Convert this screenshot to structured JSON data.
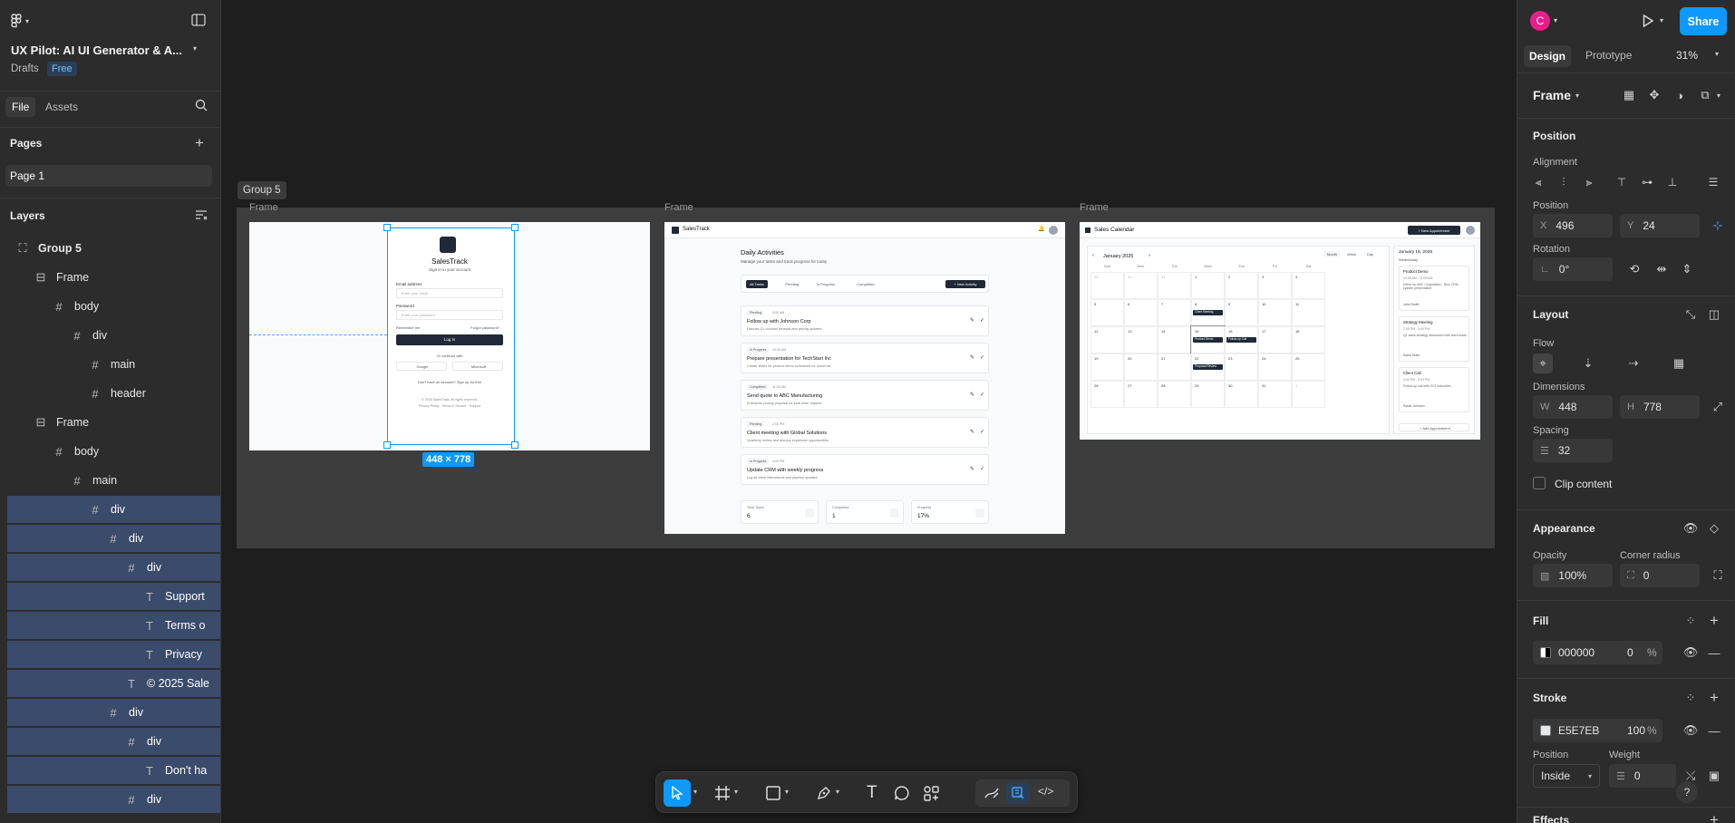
{
  "app": {
    "title": "UX Pilot: AI UI Generator & A...",
    "drafts": "Drafts",
    "plan_badge": "Free",
    "tabs": [
      "File",
      "Assets"
    ],
    "pages_label": "Pages",
    "page_name": "Page 1",
    "layers_label": "Layers"
  },
  "layers": [
    {
      "icon": "group",
      "name": "Group 5",
      "depth": 0,
      "bold": true,
      "selected": false
    },
    {
      "icon": "frame",
      "name": "Frame",
      "depth": 1,
      "selected": false
    },
    {
      "icon": "grid",
      "name": "body",
      "depth": 2,
      "selected": false
    },
    {
      "icon": "grid",
      "name": "div",
      "depth": 3,
      "selected": false
    },
    {
      "icon": "grid",
      "name": "main",
      "depth": 4,
      "selected": false
    },
    {
      "icon": "grid",
      "name": "header",
      "depth": 4,
      "selected": false
    },
    {
      "icon": "frame",
      "name": "Frame",
      "depth": 1,
      "selected": false
    },
    {
      "icon": "grid",
      "name": "body",
      "depth": 2,
      "selected": false
    },
    {
      "icon": "grid",
      "name": "main",
      "depth": 3,
      "selected": false
    },
    {
      "icon": "grid",
      "name": "div",
      "depth": 4,
      "selected": true
    },
    {
      "icon": "grid",
      "name": "div",
      "depth": 5,
      "selected": true
    },
    {
      "icon": "grid",
      "name": "div",
      "depth": 6,
      "selected": true
    },
    {
      "icon": "text",
      "name": "Support",
      "depth": 7,
      "selected": true
    },
    {
      "icon": "text",
      "name": "Terms o",
      "depth": 7,
      "selected": true
    },
    {
      "icon": "text",
      "name": "Privacy",
      "depth": 7,
      "selected": true
    },
    {
      "icon": "text",
      "name": "© 2025 Sale",
      "depth": 6,
      "selected": true
    },
    {
      "icon": "grid",
      "name": "div",
      "depth": 5,
      "selected": true
    },
    {
      "icon": "grid",
      "name": "div",
      "depth": 6,
      "selected": true
    },
    {
      "icon": "text",
      "name": "Don't ha",
      "depth": 7,
      "selected": true
    },
    {
      "icon": "grid",
      "name": "div",
      "depth": 6,
      "selected": true
    }
  ],
  "canvas": {
    "group_label": "Group 5",
    "frame_labels": [
      "Frame",
      "Frame",
      "Frame"
    ],
    "size_badge": "448 × 778"
  },
  "login": {
    "brand": "SalesTrack",
    "subtitle": "Sign in to your account",
    "email_label": "Email address",
    "email_placeholder": "Enter your email",
    "password_label": "Password",
    "password_placeholder": "Enter your password",
    "remember": "Remember me",
    "forgot": "Forgot password?",
    "login_button": "Log in",
    "continue_with": "Or continue with",
    "google": "Google",
    "microsoft": "Microsoft",
    "signup": "Don't have an account? Sign up for free",
    "footer": "© 2025 SalesTrack. All rights reserved.",
    "footer_links": [
      "Privacy Policy",
      "Terms of Service",
      "Support"
    ]
  },
  "activities": {
    "brand": "SalesTrack",
    "title": "Daily Activities",
    "subtitle": "Manage your tasks and track progress for today",
    "filters": [
      "All Tasks",
      "Pending",
      "In Progress",
      "Completed"
    ],
    "new_button": "+ New Activity",
    "tasks": [
      {
        "status": "Pending",
        "time": "9:00 AM",
        "title": "Follow up with Johnson Corp",
        "desc": "Discuss Q1 contract renewal and pricing updates"
      },
      {
        "status": "In Progress",
        "time": "10:30 AM",
        "title": "Prepare presentation for TechStart Inc",
        "desc": "Create slides for product demo scheduled for tomorrow"
      },
      {
        "status": "Completed",
        "time": "11:00 AM",
        "title": "Send quote to ABC Manufacturing",
        "desc": "Enterprise pricing proposal for bulk order request"
      },
      {
        "status": "Pending",
        "time": "2:00 PM",
        "title": "Client meeting with Global Solutions",
        "desc": "Quarterly review and discuss expansion opportunities"
      },
      {
        "status": "In Progress",
        "time": "4:00 PM",
        "title": "Update CRM with weekly progress",
        "desc": "Log all client interactions and pipeline updates"
      }
    ],
    "stats": [
      {
        "label": "Total Tasks",
        "value": "6"
      },
      {
        "label": "Completed",
        "value": "1"
      },
      {
        "label": "Progress",
        "value": "17%"
      }
    ]
  },
  "calendar": {
    "title": "Sales Calendar",
    "new_button": "+ New Appointment",
    "month": "January 2025",
    "views": [
      "Month",
      "Week",
      "Day"
    ],
    "weekdays": [
      "Sun",
      "Mon",
      "Tue",
      "Wed",
      "Thu",
      "Fri",
      "Sat"
    ],
    "days": [
      "29",
      "30",
      "31",
      "1",
      "2",
      "3",
      "4",
      "5",
      "6",
      "7",
      "8",
      "9",
      "10",
      "11",
      "12",
      "13",
      "14",
      "15",
      "16",
      "17",
      "18",
      "19",
      "20",
      "21",
      "22",
      "23",
      "24",
      "25",
      "26",
      "27",
      "28",
      "29",
      "30",
      "31",
      "1"
    ],
    "events": [
      {
        "cell": 10,
        "label": "Client Meeting"
      },
      {
        "cell": 17,
        "label": "Product Demo"
      },
      {
        "cell": 18,
        "label": "Follow-up Call"
      },
      {
        "cell": 24,
        "label": "Proposal Review"
      }
    ],
    "side_date": "January 15, 2025",
    "side_day": "Wednesday",
    "appointments": [
      {
        "title": "Product Demo",
        "time": "10:00 AM - 11:00 AM",
        "desc": "Demo for ABC Corporation - New CRM system presentation",
        "person": "John Smith"
      },
      {
        "title": "Strategy Meeting",
        "time": "2:00 PM - 3:00 PM",
        "desc": "Q1 sales strategy discussion with team leads",
        "person": "Sales Team"
      },
      {
        "title": "Client Call",
        "time": "4:30 PM - 5:00 PM",
        "desc": "Follow-up call with XYZ Industries",
        "person": "Sarah Johnson"
      }
    ],
    "add_button": "+ Add Appointment"
  },
  "design_panel": {
    "avatar_letter": "C",
    "share": "Share",
    "tabs": [
      "Design",
      "Prototype"
    ],
    "zoom": "31%",
    "frame_label": "Frame",
    "position_section": "Position",
    "alignment_label": "Alignment",
    "position_label": "Position",
    "x_label": "X",
    "x_value": "496",
    "y_label": "Y",
    "y_value": "24",
    "rotation_label": "Rotation",
    "rotation_value": "0°",
    "layout_section": "Layout",
    "flow_label": "Flow",
    "dimensions_label": "Dimensions",
    "w_label": "W",
    "w_value": "448",
    "h_label": "H",
    "h_value": "778",
    "spacing_label": "Spacing",
    "spacing_value": "32",
    "clip_content": "Clip content",
    "appearance_section": "Appearance",
    "opacity_label": "Opacity",
    "opacity_value": "100%",
    "radius_label": "Corner radius",
    "radius_value": "0",
    "fill_section": "Fill",
    "fill_hex": "000000",
    "fill_opacity": "0",
    "stroke_section": "Stroke",
    "stroke_hex": "E5E7EB",
    "stroke_opacity": "100",
    "percent": "%",
    "stroke_position_label": "Position",
    "stroke_position_value": "Inside",
    "weight_label": "Weight",
    "weight_value": "0",
    "effects_section": "Effects"
  },
  "colors": {
    "accent": "#0d99ff",
    "selection": "#3a4b6b",
    "avatar": "#e91e8c",
    "dark_button": "#1f2937"
  }
}
